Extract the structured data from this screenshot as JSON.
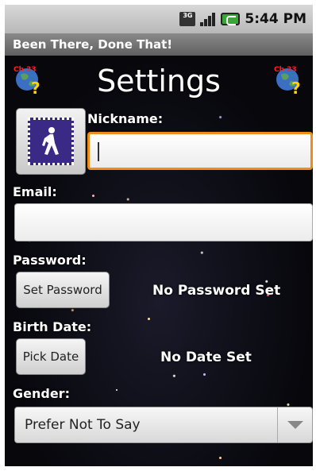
{
  "status_bar": {
    "time": "5:44 PM",
    "network_label": "3G",
    "icons": [
      "network-type-icon",
      "signal-strength-icon",
      "battery-icon"
    ]
  },
  "app": {
    "title": "Been There, Done That!"
  },
  "header": {
    "title": "Settings",
    "left_icon": "help-globe-icon",
    "right_icon": "help-globe-icon",
    "icon_caption": "Ch 23"
  },
  "form": {
    "avatar_icon": "walking-person-stamp-icon",
    "nickname_label": "Nickname:",
    "nickname_value": "",
    "email_label": "Email:",
    "email_value": "",
    "password_label": "Password:",
    "set_password_button": "Set Password",
    "password_status": "No Password Set",
    "birthdate_label": "Birth Date:",
    "pick_date_button": "Pick Date",
    "date_status": "No Date Set",
    "gender_label": "Gender:",
    "gender_selected": "Prefer Not To Say"
  },
  "colors": {
    "focus_border": "#f08c1a",
    "stamp_blue": "#3a2a86"
  }
}
